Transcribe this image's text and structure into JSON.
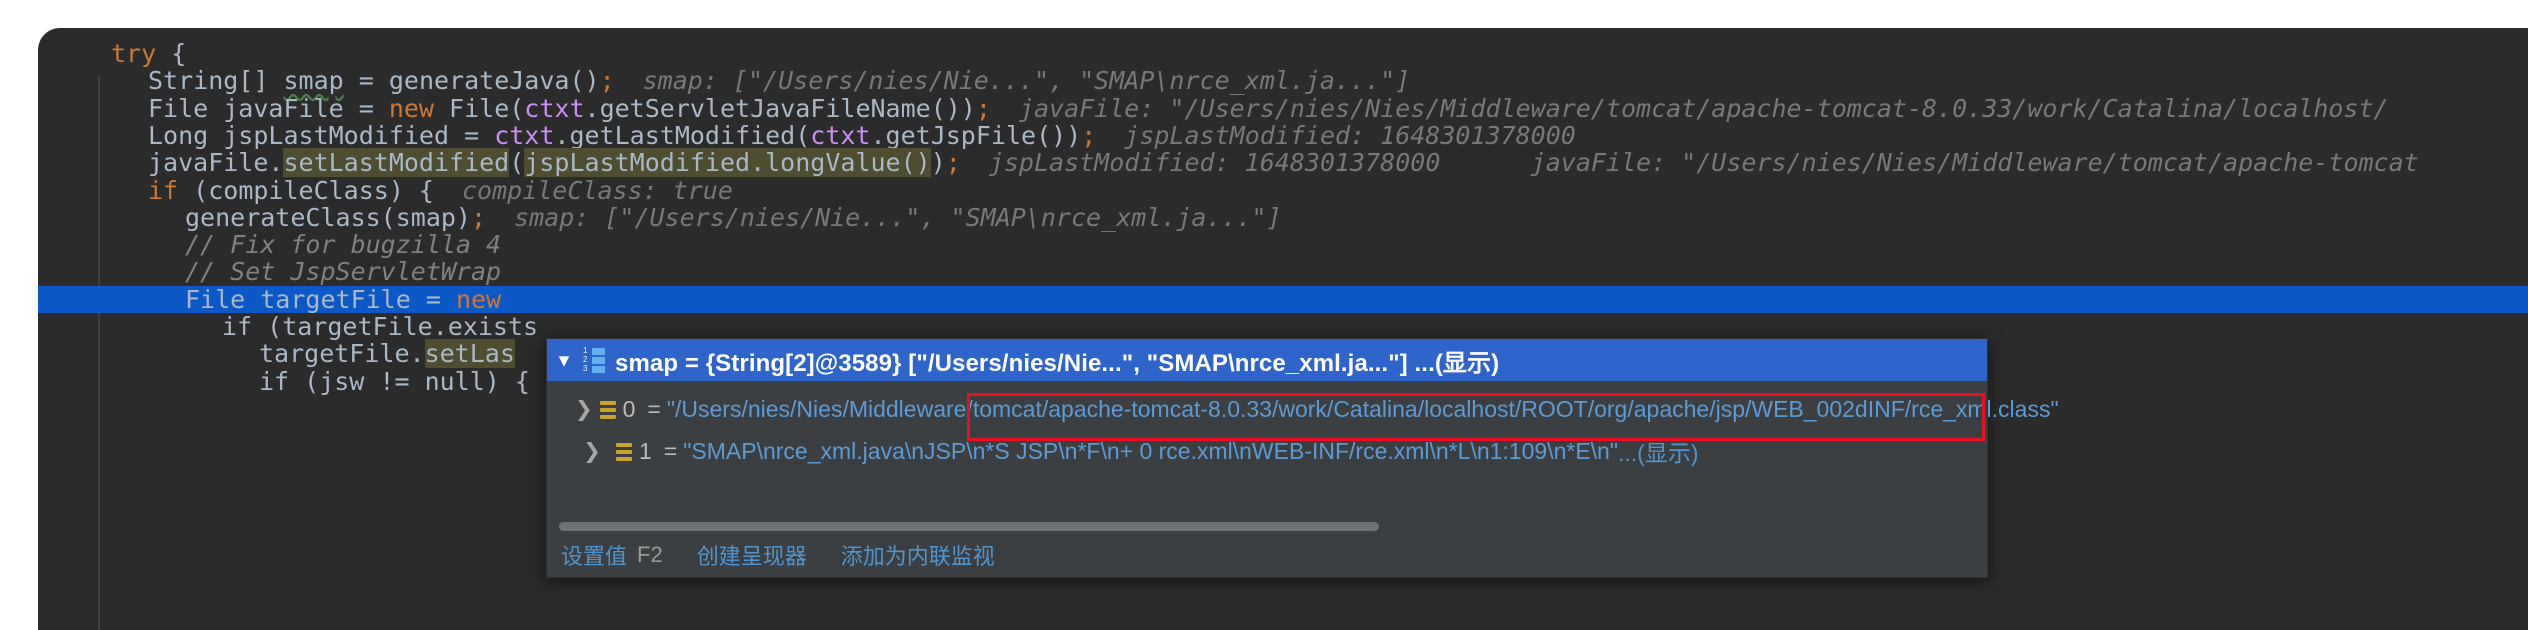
{
  "editor": {
    "lines": [
      {
        "indent": 1,
        "tokens": [
          {
            "t": "try ",
            "c": "kw"
          },
          {
            "t": "{",
            "c": "txt"
          }
        ],
        "hint": ""
      },
      {
        "indent": 2,
        "tokens": [
          {
            "t": "String[] ",
            "c": "txt"
          },
          {
            "t": "smap",
            "c": "squiggle"
          },
          {
            "t": " = generateJava()",
            "c": "txt"
          },
          {
            "t": ";",
            "c": "semi"
          }
        ],
        "hint": "smap: [\"/Users/nies/Nie...\", \"SMAP\\nrce_xml.ja...\"]"
      },
      {
        "indent": 2,
        "tokens": [
          {
            "t": "File javaFile = ",
            "c": "txt"
          },
          {
            "t": "new",
            "c": "kw"
          },
          {
            "t": " File(",
            "c": "txt"
          },
          {
            "t": "ctxt",
            "c": "meth"
          },
          {
            "t": ".getServletJavaFileName())",
            "c": "txt"
          },
          {
            "t": ";",
            "c": "semi"
          }
        ],
        "hint": "javaFile: \"/Users/nies/Nies/Middleware/tomcat/apache-tomcat-8.0.33/work/Catalina/localhost/"
      },
      {
        "indent": 2,
        "tokens": [
          {
            "t": "Long jspLastModified = ",
            "c": "txt"
          },
          {
            "t": "ctxt",
            "c": "meth"
          },
          {
            "t": ".getLastModified(",
            "c": "txt"
          },
          {
            "t": "ctxt",
            "c": "meth"
          },
          {
            "t": ".getJspFile())",
            "c": "txt"
          },
          {
            "t": ";",
            "c": "semi"
          }
        ],
        "hint": "jspLastModified: 1648301378000"
      },
      {
        "indent": 2,
        "tokens": [
          {
            "t": "javaFile.",
            "c": "txt"
          },
          {
            "t": "setLastModified",
            "c": "hl"
          },
          {
            "t": "(",
            "c": "txt"
          },
          {
            "t": "jspLastModified.longValue()",
            "c": "hl"
          },
          {
            "t": ")",
            "c": "txt"
          },
          {
            "t": ";",
            "c": "semi"
          }
        ],
        "hint": "jspLastModified: 1648301378000      javaFile: \"/Users/nies/Nies/Middleware/tomcat/apache-tomcat"
      },
      {
        "indent": 2,
        "tokens": [
          {
            "t": "if",
            "c": "kw"
          },
          {
            "t": " (compileClass) {",
            "c": "txt"
          }
        ],
        "hint": "compileClass: true"
      },
      {
        "indent": 3,
        "tokens": [
          {
            "t": "generateClass(smap)",
            "c": "txt"
          },
          {
            "t": ";",
            "c": "semi"
          }
        ],
        "hint": "smap: [\"/Users/nies/Nie...\", \"SMAP\\nrce_xml.ja...\"]"
      },
      {
        "indent": 3,
        "tokens": [
          {
            "t": "// Fix for bugzilla 4",
            "c": "cmt"
          }
        ],
        "hint": ""
      },
      {
        "indent": 3,
        "tokens": [
          {
            "t": "// Set JspServletWrap",
            "c": "cmt"
          }
        ],
        "hint": ""
      },
      {
        "indent": 3,
        "tokens": [
          {
            "t": "File targetFile = ",
            "c": "txt"
          },
          {
            "t": "new",
            "c": "kw"
          }
        ],
        "hint": "",
        "selected": true
      },
      {
        "indent": 4,
        "tokens": [
          {
            "t": "if (targetFile.exists",
            "c": "txt"
          }
        ],
        "hint": ""
      },
      {
        "indent": 5,
        "tokens": [
          {
            "t": "targetFile.",
            "c": "txt"
          },
          {
            "t": "setLas",
            "c": "hl"
          }
        ],
        "hint": ""
      },
      {
        "indent": 5,
        "tokens": [
          {
            "t": "if (jsw != null) {",
            "c": "txt"
          }
        ],
        "hint": ""
      }
    ]
  },
  "popup": {
    "header": {
      "chevron": "chevron-down",
      "icon": "array-icon",
      "label": "smap = {String[2]@3589} [\"/Users/nies/Nie...\", \"SMAP\\nrce_xml.ja...\"] ...(显示)"
    },
    "rows": [
      {
        "chevron": "chevron-right",
        "icon": "array-element-icon",
        "name": "0",
        "eq": "=",
        "value": "\"/Users/nies/Nies/Middleware/tomcat/apache-tomcat-8.0.33/work/Catalina/localhost/ROOT/org/apache/jsp/WEB_002dINF/rce_xml.class\"",
        "highlighted": true
      },
      {
        "chevron": "chevron-right",
        "icon": "array-element-icon",
        "name": "1",
        "eq": "=",
        "value": "\"SMAP\\nrce_xml.java\\nJSP\\n*S JSP\\n*F\\n+ 0 rce.xml\\nWEB-INF/rce.xml\\n*L\\n1:109\\n*E\\n\"",
        "more": "...(显示)",
        "highlighted": false
      }
    ],
    "actions": [
      {
        "label": "设置值",
        "key": "F2"
      },
      {
        "label": "创建呈现器",
        "key": ""
      },
      {
        "label": "添加为内联监视",
        "key": ""
      }
    ],
    "scrollbar": {
      "name": "horizontal-scrollbar"
    }
  },
  "colors": {
    "editor_bg": "#2b2b2b",
    "selection_blue": "#0d58c7",
    "popup_bg": "#3c3f41",
    "popup_header_blue": "#2f65ca",
    "red_outline": "#e81123",
    "string_green": "#6aab73",
    "link_blue": "#4e94ce",
    "keyword_orange": "#cc7832",
    "method_purple": "#ca8ef7",
    "hint_gray": "#75797c",
    "highlight_olive": "#4e4d30"
  }
}
